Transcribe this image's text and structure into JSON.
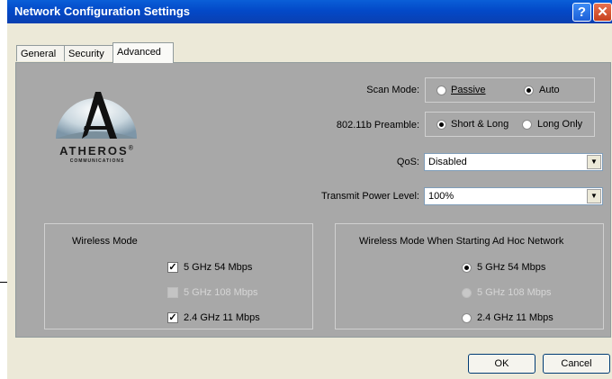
{
  "window": {
    "title": "Network Configuration Settings",
    "help_glyph": "?",
    "close_glyph": "✕"
  },
  "tabs": [
    {
      "label": "General"
    },
    {
      "label": "Security"
    },
    {
      "label": "Advanced"
    }
  ],
  "logo": {
    "brand": "ATHEROS",
    "registered": "®",
    "sub": "COMMUNICATIONS"
  },
  "scan_mode": {
    "label": "Scan Mode:",
    "options": [
      "Passive",
      "Auto"
    ],
    "selected": "Auto"
  },
  "preamble": {
    "label": "802.11b Preamble:",
    "options": [
      "Short & Long",
      "Long Only"
    ],
    "selected": "Short & Long"
  },
  "qos": {
    "label": "QoS:",
    "value": "Disabled"
  },
  "tx_power": {
    "label": "Transmit Power Level:",
    "value": "100%"
  },
  "wireless_mode": {
    "title": "Wireless Mode",
    "items": [
      {
        "label": "5 GHz 54 Mbps",
        "checked": true,
        "enabled": true
      },
      {
        "label": "5 GHz 108 Mbps",
        "checked": false,
        "enabled": false
      },
      {
        "label": "2.4 GHz 11 Mbps",
        "checked": true,
        "enabled": true
      }
    ]
  },
  "adhoc_mode": {
    "title": "Wireless Mode When Starting Ad Hoc Network",
    "items": [
      {
        "label": "5 GHz 54 Mbps",
        "selected": true,
        "enabled": true
      },
      {
        "label": "5 GHz 108 Mbps",
        "selected": false,
        "enabled": false
      },
      {
        "label": "2.4 GHz 11 Mbps",
        "selected": false,
        "enabled": true
      }
    ]
  },
  "buttons": {
    "ok": "OK",
    "cancel": "Cancel"
  },
  "colors": {
    "titlebar": "#0349c8",
    "panel": "#a8a8a8",
    "dialog": "#ece9d8"
  }
}
